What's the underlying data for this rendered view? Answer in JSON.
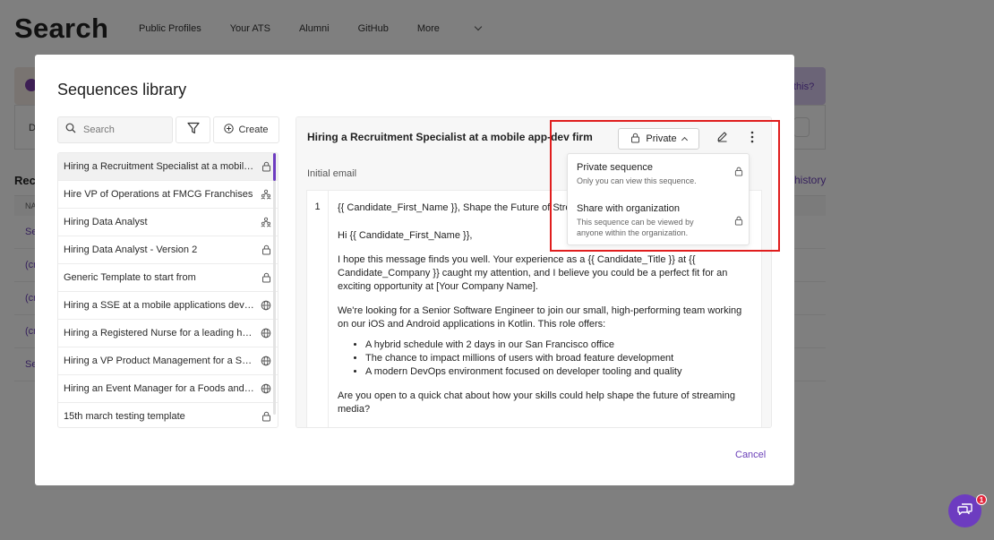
{
  "background": {
    "title": "Search",
    "nav": [
      "Public Profiles",
      "Your ATS",
      "Alumni",
      "GitHub",
      "More"
    ],
    "banner_link": "this?",
    "card_text": "D",
    "recent_label": "Rec",
    "history_link": "history",
    "table_header": "NA",
    "rows": [
      "Se",
      "(cr",
      "(cr",
      "(cr",
      "Se"
    ]
  },
  "modal": {
    "title": "Sequences library",
    "search_placeholder": "Search",
    "create_label": "Create",
    "cancel_label": "Cancel"
  },
  "sequences": [
    {
      "label": "Hiring a Recruitment Specialist at a mobile app-dev firm",
      "icon": "lock-icon",
      "selected": true
    },
    {
      "label": "Hire VP of Operations at FMCG Franchises",
      "icon": "people-icon"
    },
    {
      "label": "Hiring Data Analyst",
      "icon": "people-icon"
    },
    {
      "label": "Hiring Data Analyst - Version 2",
      "icon": "lock-icon"
    },
    {
      "label": "Generic Template to start from",
      "icon": "lock-icon"
    },
    {
      "label": "Hiring a SSE at a mobile applications development firm",
      "icon": "globe-icon"
    },
    {
      "label": "Hiring a Registered Nurse for a leading hospital",
      "icon": "globe-icon"
    },
    {
      "label": "Hiring a VP Product Management for a Series B startup",
      "icon": "globe-icon"
    },
    {
      "label": "Hiring an Event Manager for a Foods and Beverages company",
      "icon": "globe-icon"
    },
    {
      "label": "15th march testing template",
      "icon": "lock-icon"
    }
  ],
  "detail": {
    "title": "Hiring a Recruitment Specialist at a mobile app-dev firm",
    "visibility_label": "Private",
    "step_label": "Initial email",
    "step_number": "1",
    "subject": "{{ Candidate_First_Name }}, Shape the Future of Streaming with Us!",
    "greeting": "Hi {{ Candidate_First_Name }},",
    "para1": "I hope this message finds you well. Your experience as a {{ Candidate_Title }} at {{ Candidate_Company }} caught my attention, and I believe you could be a perfect fit for an exciting opportunity at [Your Company Name].",
    "para2": "We're looking for a Senior Software Engineer to join our small, high-performing team working on our iOS and Android applications in Kotlin. This role offers:",
    "bullets": [
      "A hybrid schedule with 2 days in our San Francisco office",
      "The chance to impact millions of users with broad feature development",
      "A modern DevOps environment focused on developer tooling and quality"
    ],
    "para3": "Are you open to a quick chat about how your skills could help shape the future of streaming media?"
  },
  "dropdown": {
    "items": [
      {
        "title": "Private sequence",
        "desc": "Only you can view this sequence."
      },
      {
        "title": "Share with organization",
        "desc": "This sequence can be viewed by anyone within the organization."
      }
    ]
  },
  "chat": {
    "badge_count": "1"
  },
  "colors": {
    "accent": "#6d3cc0",
    "highlight": "#e01e1e"
  }
}
